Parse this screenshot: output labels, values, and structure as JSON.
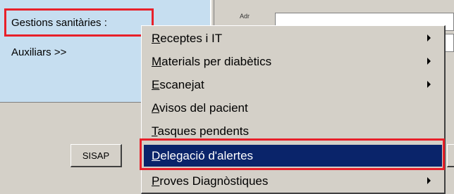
{
  "panel": {
    "links": [
      {
        "label": "Gestions sanitàries :"
      },
      {
        "label": "Auxiliars >>"
      }
    ],
    "field_label": "Adr"
  },
  "buttons": {
    "sisap": "SISAP"
  },
  "menu": {
    "items": [
      {
        "accel": "R",
        "rest": "eceptes i IT",
        "submenu": true
      },
      {
        "accel": "M",
        "rest": "aterials per diabètics",
        "submenu": true
      },
      {
        "accel": "E",
        "rest": "scanejat",
        "submenu": true
      },
      {
        "accel": "A",
        "rest": "visos del pacient",
        "submenu": false
      },
      {
        "accel": "T",
        "rest": "asques pendents",
        "submenu": false
      },
      {
        "accel": "D",
        "rest": "elegació d'alertes",
        "submenu": false,
        "selected": true
      },
      {
        "accel": "P",
        "rest": "roves Diagnòstiques",
        "submenu": true
      }
    ]
  },
  "colors": {
    "panel_bg": "#c6def0",
    "highlight_border": "#e8202a",
    "menu_selected": "#0a246a"
  }
}
